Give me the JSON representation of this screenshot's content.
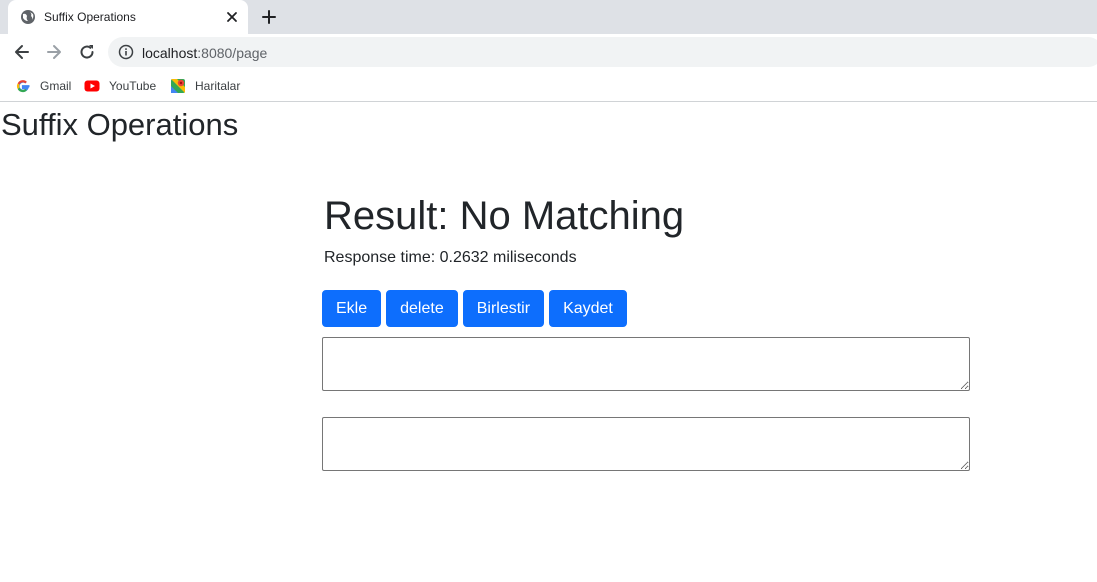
{
  "browser": {
    "tab_title": "Suffix Operations",
    "url_host": "localhost",
    "url_path": ":8080/page",
    "bookmarks": [
      {
        "label": "Gmail",
        "icon": "google-icon"
      },
      {
        "label": "YouTube",
        "icon": "youtube-icon"
      },
      {
        "label": "Haritalar",
        "icon": "maps-icon"
      }
    ]
  },
  "page": {
    "title": "Suffix Operations",
    "result": "Result: No Matching",
    "response_time": "Response time: 0.2632 miliseconds",
    "buttons": [
      {
        "label": "Ekle"
      },
      {
        "label": "delete"
      },
      {
        "label": "Birlestir"
      },
      {
        "label": "Kaydet"
      }
    ],
    "textarea_1_value": "",
    "textarea_2_value": ""
  },
  "colors": {
    "primary_button": "#0d6efd",
    "tabstrip": "#dee1e6",
    "omnibox": "#f1f3f4"
  }
}
